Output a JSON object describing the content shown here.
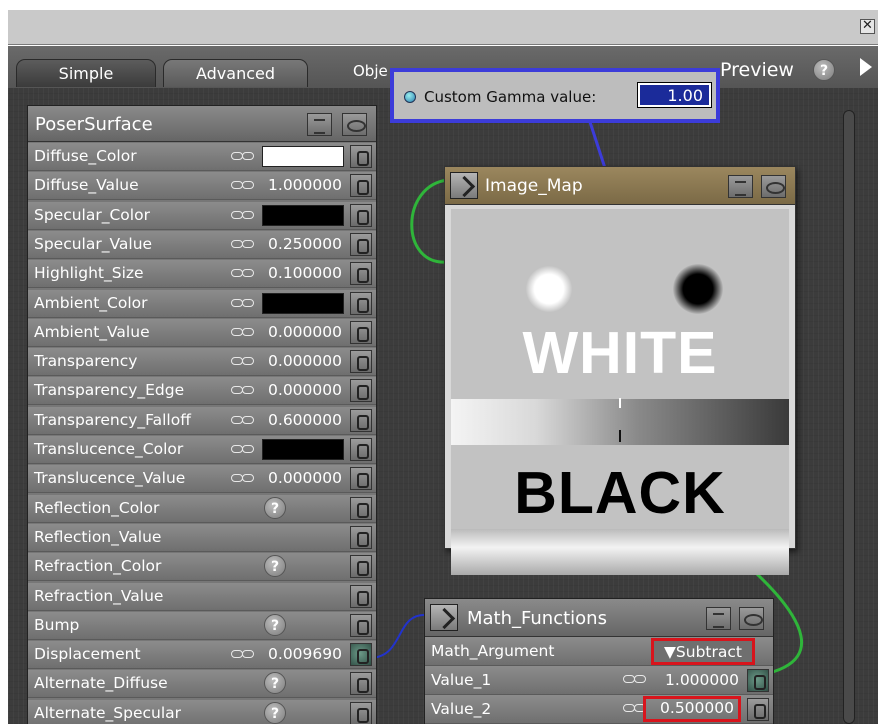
{
  "window": {
    "close_glyph": "✕"
  },
  "tabs": {
    "simple": "Simple",
    "advanced": "Advanced"
  },
  "toolbar": {
    "object_label": "Obje",
    "preview_label": "Preview",
    "help_glyph": "?"
  },
  "poser_surface": {
    "title": "PoserSurface",
    "rows": [
      {
        "label": "Diffuse_Color",
        "kind": "color",
        "color": "#ffffff"
      },
      {
        "label": "Diffuse_Value",
        "kind": "value",
        "value": "1.000000"
      },
      {
        "label": "Specular_Color",
        "kind": "color",
        "color": "#000000"
      },
      {
        "label": "Specular_Value",
        "kind": "value",
        "value": "0.250000"
      },
      {
        "label": "Highlight_Size",
        "kind": "value",
        "value": "0.100000"
      },
      {
        "label": "Ambient_Color",
        "kind": "color",
        "color": "#000000"
      },
      {
        "label": "Ambient_Value",
        "kind": "value",
        "value": "0.000000"
      },
      {
        "label": "Transparency",
        "kind": "value",
        "value": "0.000000"
      },
      {
        "label": "Transparency_Edge",
        "kind": "value",
        "value": "0.000000"
      },
      {
        "label": "Transparency_Falloff",
        "kind": "value",
        "value": "0.600000"
      },
      {
        "label": "Translucence_Color",
        "kind": "color",
        "color": "#000000"
      },
      {
        "label": "Translucence_Value",
        "kind": "value",
        "value": "0.000000"
      },
      {
        "label": "Reflection_Color",
        "kind": "help"
      },
      {
        "label": "Reflection_Value",
        "kind": "empty"
      },
      {
        "label": "Refraction_Color",
        "kind": "help"
      },
      {
        "label": "Refraction_Value",
        "kind": "empty"
      },
      {
        "label": "Bump",
        "kind": "help"
      },
      {
        "label": "Displacement",
        "kind": "value",
        "value": "0.009690",
        "connected": true
      },
      {
        "label": "Alternate_Diffuse",
        "kind": "help"
      },
      {
        "label": "Alternate_Specular",
        "kind": "help"
      }
    ]
  },
  "image_map": {
    "title": "Image_Map",
    "preview_text_top": "WHITE",
    "preview_text_bottom": "BLACK"
  },
  "math_functions": {
    "title": "Math_Functions",
    "argument_label": "Math_Argument",
    "argument_value": "▼Subtract",
    "value1_label": "Value_1",
    "value1": "1.000000",
    "value2_label": "Value_2",
    "value2": "0.500000"
  },
  "gamma": {
    "label": "Custom Gamma value:",
    "value": "1.00"
  },
  "colors": {
    "callout_border": "#3c3cd9",
    "highlight_red": "#d8141c",
    "wire_green": "#2fb53a",
    "wire_blue": "#2233cc",
    "image_map_header": "#8b7650"
  }
}
